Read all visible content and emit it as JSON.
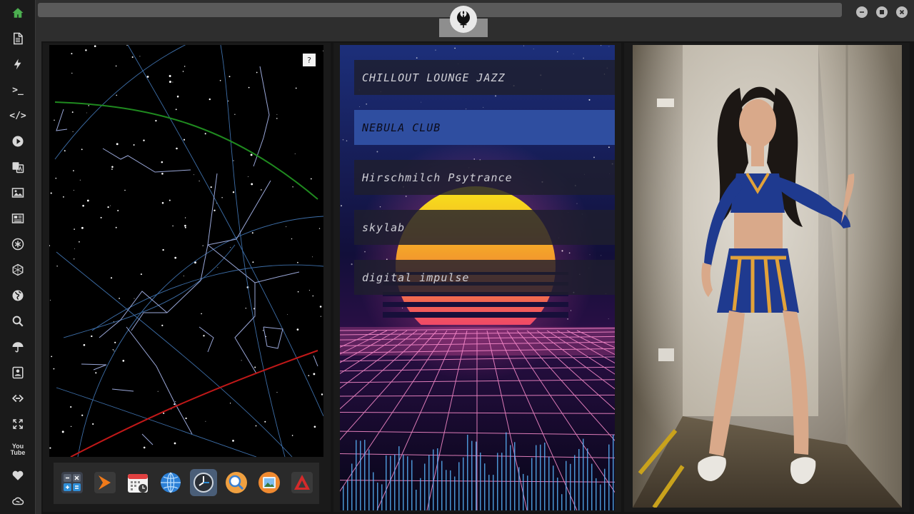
{
  "sidebar": {
    "items": [
      {
        "icon": "home-icon",
        "name": "sidebar-item-home"
      },
      {
        "icon": "document-icon",
        "name": "sidebar-item-documents"
      },
      {
        "icon": "lightning-icon",
        "name": "sidebar-item-power"
      },
      {
        "icon": "terminal-icon",
        "label": ">_",
        "name": "sidebar-item-terminal"
      },
      {
        "icon": "code-icon",
        "label": "</>",
        "name": "sidebar-item-code"
      },
      {
        "icon": "play-icon",
        "name": "sidebar-item-media"
      },
      {
        "icon": "translate-icon",
        "name": "sidebar-item-translate"
      },
      {
        "icon": "image-icon",
        "name": "sidebar-item-images"
      },
      {
        "icon": "news-icon",
        "name": "sidebar-item-news"
      },
      {
        "icon": "asterisk-icon",
        "name": "sidebar-item-misc"
      },
      {
        "icon": "hexagon-icon",
        "name": "sidebar-item-network"
      },
      {
        "icon": "globe-icon",
        "name": "sidebar-item-globe"
      },
      {
        "icon": "search-icon",
        "name": "sidebar-item-search"
      },
      {
        "icon": "umbrella-icon",
        "name": "sidebar-item-weather"
      },
      {
        "icon": "contacts-icon",
        "name": "sidebar-item-contacts"
      },
      {
        "icon": "link-icon",
        "name": "sidebar-item-links"
      },
      {
        "icon": "expand-icon",
        "name": "sidebar-item-fullscreen"
      },
      {
        "icon": "youtube-icon",
        "label": "You Tube",
        "name": "sidebar-item-youtube"
      },
      {
        "icon": "heart-icon",
        "name": "sidebar-item-favorites"
      },
      {
        "icon": "cloud-icon",
        "name": "sidebar-item-cloud"
      }
    ]
  },
  "header": {
    "logo_icon": "rebel-alliance-icon",
    "window_controls": [
      "minimize-icon",
      "maximize-icon",
      "close-icon"
    ]
  },
  "skymap": {
    "help_label": "?"
  },
  "dock": {
    "apps": [
      "calculator-icon",
      "terminal-arrow-icon",
      "calendar-icon",
      "globe-icon",
      "clock-icon",
      "search-icon",
      "photos-icon",
      "vpn-icon"
    ]
  },
  "radio": {
    "stations": [
      {
        "label": "CHILLOUT LOUNGE JAZZ",
        "active": false
      },
      {
        "label": "NEBULA CLUB",
        "active": true
      },
      {
        "label": "Hirschmilch Psytrance",
        "active": false
      },
      {
        "label": "skylab",
        "active": false
      },
      {
        "label": "digital impulse",
        "active": false
      }
    ]
  },
  "colors": {
    "accent_green": "#4caf50",
    "station_active": "#2f4ea0",
    "horizon_green": "#1f8a1f",
    "ecliptic_red": "#c01818"
  }
}
